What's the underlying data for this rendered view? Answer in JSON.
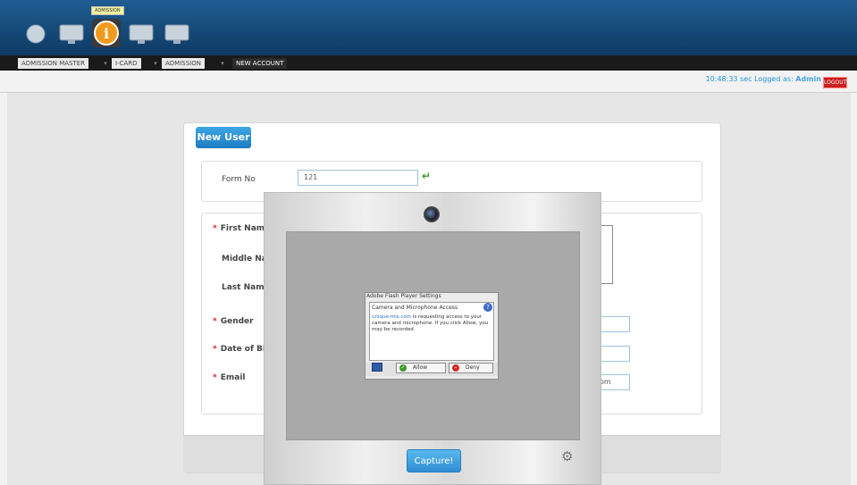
{
  "topbar": {
    "tooltip": "ADMISSION",
    "icons": [
      "nav-icon-1",
      "monitor-icon",
      "info-icon",
      "monitor-icon",
      "monitor-icon"
    ]
  },
  "tabs": [
    {
      "label": "ADMISSION MASTER",
      "active": false
    },
    {
      "label": "I-CARD",
      "active": false
    },
    {
      "label": "ADMISSION",
      "active": false
    },
    {
      "label": "NEW ACCOUNT",
      "active": true
    }
  ],
  "status": {
    "time_text": "10:48:33 sec Logged as:",
    "user": "Admin",
    "logout_label": "LOGOUT"
  },
  "form": {
    "title": "New User",
    "form_no_label": "Form No",
    "form_no_value": "121",
    "fields": {
      "first_name": "First Name",
      "middle_name": "Middle Nar",
      "last_name": "Last Name",
      "gender": "Gender",
      "dob": "Date of Bi",
      "email": "Email"
    },
    "email_value_tail": "om"
  },
  "camera_popup": {
    "capture_label": "Capture!"
  },
  "flash_dialog": {
    "title": "Adobe Flash Player Settings",
    "heading": "Camera and Microphone Access",
    "domain": "unique-mis.com",
    "message": " is requesting access to your camera and microphone. If you click Allow, you may be recorded.",
    "allow_label": "Allow",
    "deny_label": "Deny"
  }
}
